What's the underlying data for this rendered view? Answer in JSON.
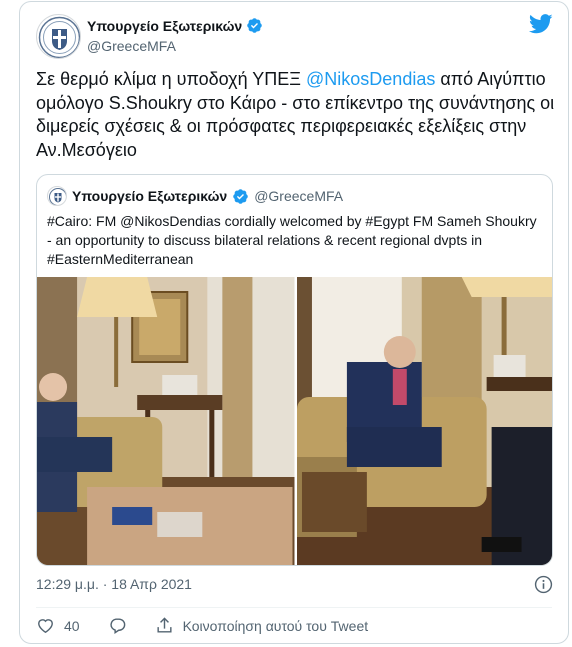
{
  "tweet": {
    "author_name": "Υπουργείο Εξωτερικών",
    "author_handle": "@GreeceMFA",
    "text_parts": {
      "pre": "Σε θερμό κλίμα η υποδοχή ΥΠΕΞ ",
      "mention": "@NikosDendias",
      "post": " από Αιγύπτιο ομόλογο S.Shoukry στο Κάιρο -  στο επίκεντρο της συνάντησης οι διμερείς σχέσεις & οι πρόσφατες περιφερειακές εξελίξεις στην Αν.Μεσόγειο"
    },
    "timestamp": "12:29 μ.μ. · 18 Απρ 2021",
    "likes": "40",
    "share_label": "Κοινοποίηση αυτού του Tweet"
  },
  "quoted": {
    "author_name": "Υπουργείο Εξωτερικών",
    "author_handle": "@GreeceMFA",
    "text": "#Cairo: FM @NikosDendias cordially welcomed by #Egypt FM Sameh Shoukry - an opportunity to discuss bilateral relations & recent regional dvpts in #EasternMediterranean"
  },
  "icons": {
    "brand": "twitter-bird-icon",
    "verified": "verified-badge-icon",
    "like": "heart-icon",
    "reply": "reply-bubble-icon",
    "share": "share-icon",
    "info": "info-icon"
  },
  "colors": {
    "accent": "#1d9bf0",
    "text": "#0f1419",
    "muted": "#536471",
    "border": "#cfd9de"
  }
}
